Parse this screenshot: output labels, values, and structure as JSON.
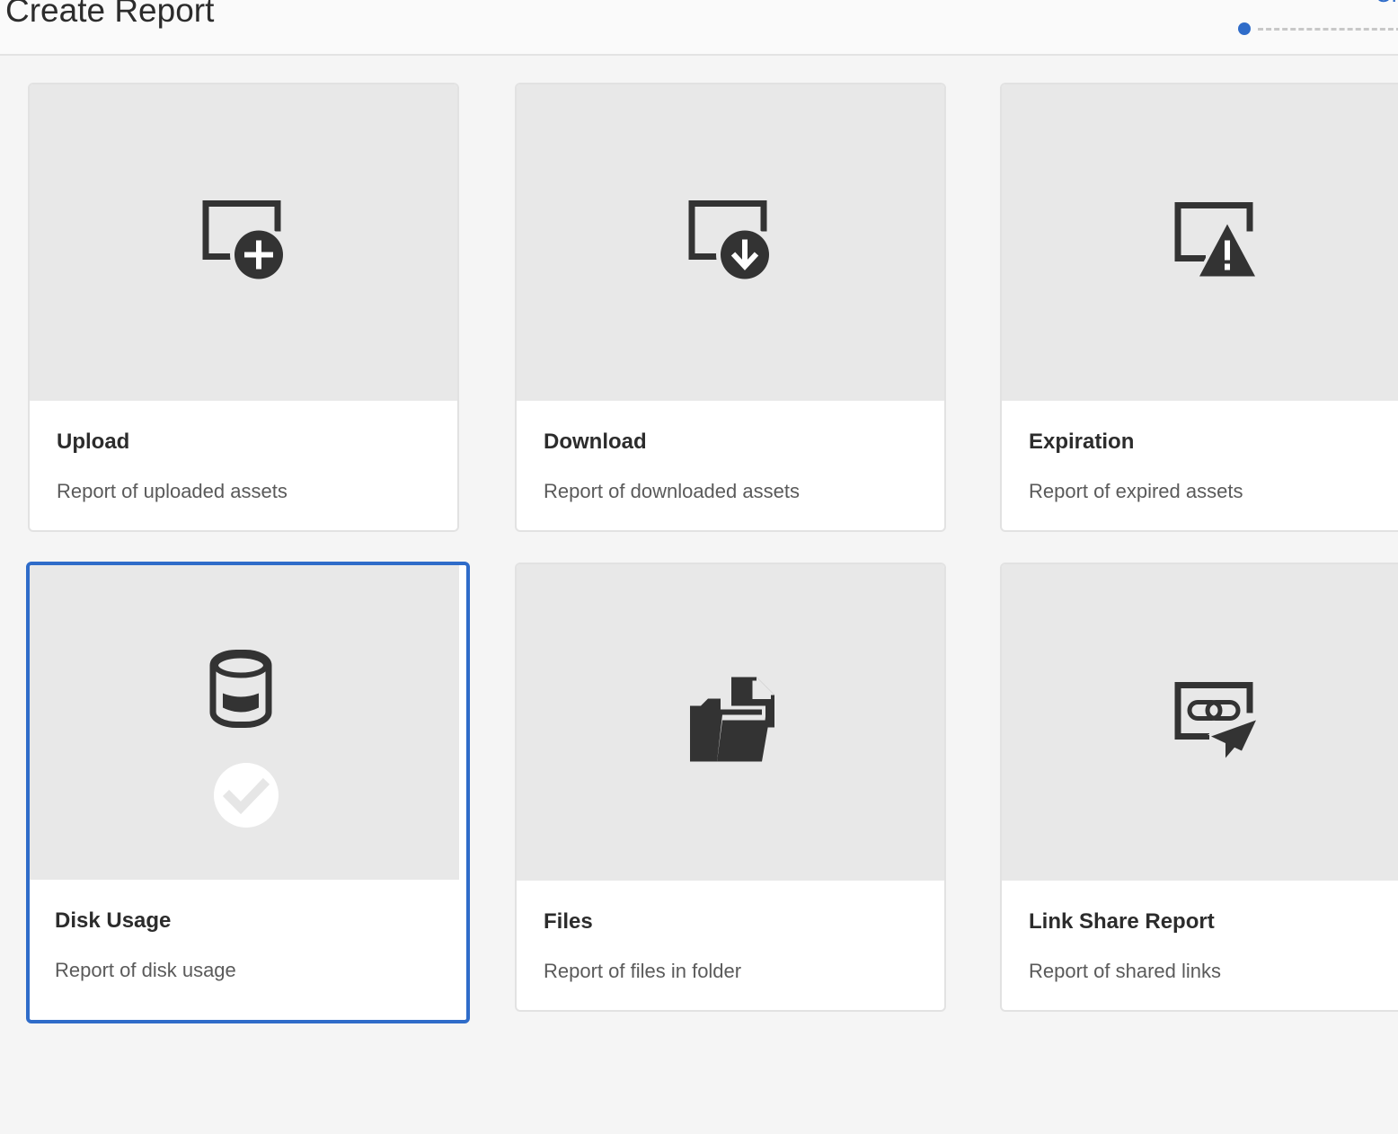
{
  "header": {
    "title": "Create Report",
    "next_step_label": "Cr"
  },
  "accent_color": "#2f6cc9",
  "cards": [
    {
      "title": "Upload",
      "description": "Report of uploaded assets",
      "icon": "upload-report-icon",
      "selected": false
    },
    {
      "title": "Download",
      "description": "Report of downloaded assets",
      "icon": "download-report-icon",
      "selected": false
    },
    {
      "title": "Expiration",
      "description": "Report of expired assets",
      "icon": "expiration-warning-icon",
      "selected": false
    },
    {
      "title": "Disk Usage",
      "description": "Report of disk usage",
      "icon": "database-icon",
      "selected": true
    },
    {
      "title": "Files",
      "description": "Report of files in folder",
      "icon": "folder-files-icon",
      "selected": false
    },
    {
      "title": "Link Share Report",
      "description": "Report of shared links",
      "icon": "link-share-icon",
      "selected": false
    }
  ]
}
